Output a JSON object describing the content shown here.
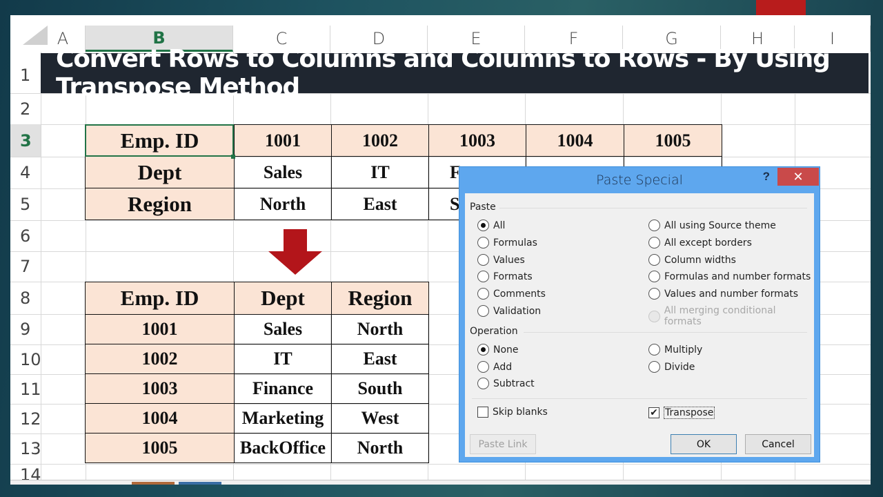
{
  "spreadsheet": {
    "columns": [
      "A",
      "B",
      "C",
      "D",
      "E",
      "F",
      "G",
      "H",
      "I"
    ],
    "selected_column": "B",
    "rows": [
      "1",
      "2",
      "3",
      "4",
      "5",
      "6",
      "7",
      "8",
      "9",
      "10",
      "11",
      "12",
      "13",
      "14"
    ],
    "selected_row": "3",
    "title": "Convert Rows to Columns and Columns to Rows - By Using Transpose Method",
    "source_table": {
      "header_row": [
        "Emp. ID",
        "1001",
        "1002",
        "1003",
        "1004",
        "1005"
      ],
      "rows": [
        [
          "Dept",
          "Sales",
          "IT",
          "F"
        ],
        [
          "Region",
          "North",
          "East",
          "S"
        ]
      ]
    },
    "transposed_table": {
      "headers": [
        "Emp. ID",
        "Dept",
        "Region"
      ],
      "rows": [
        [
          "1001",
          "Sales",
          "North"
        ],
        [
          "1002",
          "IT",
          "East"
        ],
        [
          "1003",
          "Finance",
          "South"
        ],
        [
          "1004",
          "Marketing",
          "West"
        ],
        [
          "1005",
          "BackOffice",
          "North"
        ]
      ]
    },
    "arrow_icon": "arrow-down-icon"
  },
  "dialog": {
    "title": "Paste Special",
    "help_label": "?",
    "close_label": "✕",
    "paste_group": "Paste",
    "paste_options_left": [
      {
        "label": "All",
        "selected": true
      },
      {
        "label": "Formulas",
        "selected": false
      },
      {
        "label": "Values",
        "selected": false
      },
      {
        "label": "Formats",
        "selected": false
      },
      {
        "label": "Comments",
        "selected": false
      },
      {
        "label": "Validation",
        "selected": false
      }
    ],
    "paste_options_right": [
      {
        "label": "All using Source theme",
        "selected": false
      },
      {
        "label": "All except borders",
        "selected": false
      },
      {
        "label": "Column widths",
        "selected": false
      },
      {
        "label": "Formulas and number formats",
        "selected": false
      },
      {
        "label": "Values and number formats",
        "selected": false
      },
      {
        "label": "All merging conditional formats",
        "selected": false,
        "disabled": true
      }
    ],
    "operation_group": "Operation",
    "operation_options_left": [
      {
        "label": "None",
        "selected": true
      },
      {
        "label": "Add",
        "selected": false
      },
      {
        "label": "Subtract",
        "selected": false
      }
    ],
    "operation_options_right": [
      {
        "label": "Multiply",
        "selected": false
      },
      {
        "label": "Divide",
        "selected": false
      }
    ],
    "skip_blanks": {
      "label": "Skip blanks",
      "checked": false
    },
    "transpose": {
      "label": "Transpose",
      "checked": true
    },
    "paste_link_label": "Paste Link",
    "ok_label": "OK",
    "cancel_label": "Cancel"
  }
}
